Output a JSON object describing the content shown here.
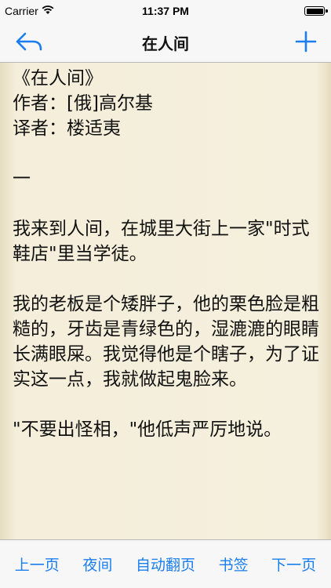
{
  "status_bar": {
    "carrier": "Carrier",
    "time": "11:37 PM"
  },
  "nav": {
    "title": "在人间"
  },
  "book": {
    "lines": [
      "《在人间》",
      "作者：[俄]高尔基",
      "译者：楼适夷",
      "",
      "一",
      "",
      "我来到人间，在城里大街上一家\"时式鞋店\"里当学徒。",
      "",
      "我的老板是个矮胖子，他的栗色脸是粗糙的，牙齿是青绿色的，湿漉漉的眼睛长满眼屎。我觉得他是个瞎子，为了证实这一点，我就做起鬼脸来。",
      "",
      "\"不要出怪相，\"他低声严厉地说。"
    ]
  },
  "toolbar": {
    "prev_page": "上一页",
    "night": "夜间",
    "auto_turn": "自动翻页",
    "bookmark": "书签",
    "next_page": "下一页"
  },
  "colors": {
    "accent": "#1a7ef0",
    "page_bg": "#f4efdc"
  },
  "icons": {
    "back": "back-arrow-icon",
    "add": "plus-icon",
    "wifi": "wifi-icon",
    "battery": "battery-icon"
  }
}
